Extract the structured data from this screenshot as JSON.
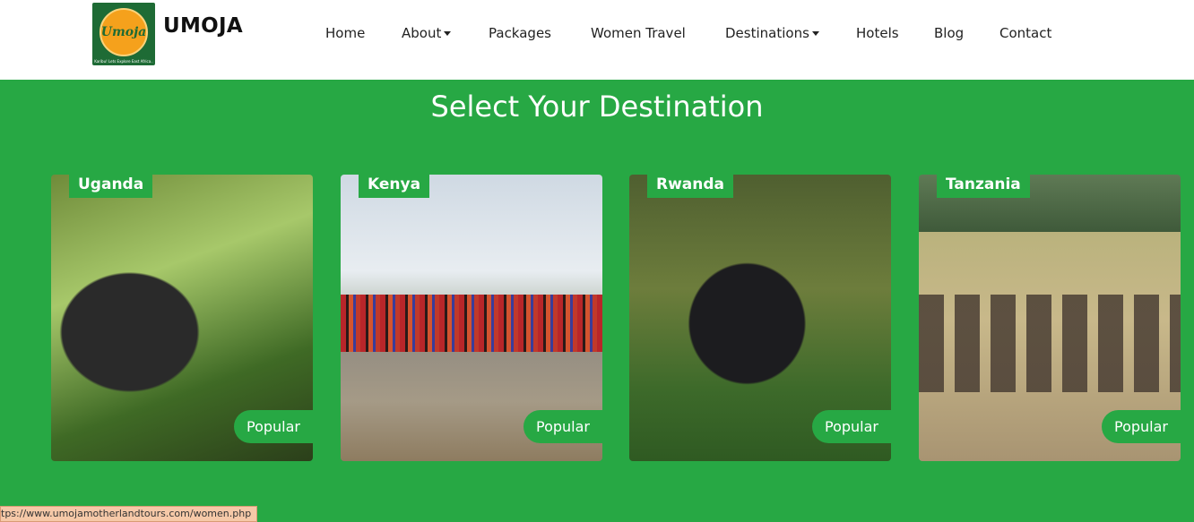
{
  "brand": {
    "name": "UMOJA",
    "logo_text": "Umoja",
    "logo_tagline": "Karibu! Lets Explore East Africa.."
  },
  "nav": {
    "home": "Home",
    "about": "About",
    "packages": "Packages",
    "women_travel": "Women Travel",
    "destinations": "Destinations",
    "hotels": "Hotels",
    "blog": "Blog",
    "contact": "Contact"
  },
  "section": {
    "title": "Select Your Destination"
  },
  "cards": [
    {
      "name": "Uganda",
      "badge": "Popular"
    },
    {
      "name": "Kenya",
      "badge": "Popular"
    },
    {
      "name": "Rwanda",
      "badge": "Popular"
    },
    {
      "name": "Tanzania",
      "badge": "Popular"
    }
  ],
  "status_bar": {
    "url": "tps://www.umojamotherlandtours.com/women.php"
  },
  "colors": {
    "brand_green": "#27a844",
    "navbar_bg": "#ffffff",
    "logo_orange": "#f5a11c"
  }
}
